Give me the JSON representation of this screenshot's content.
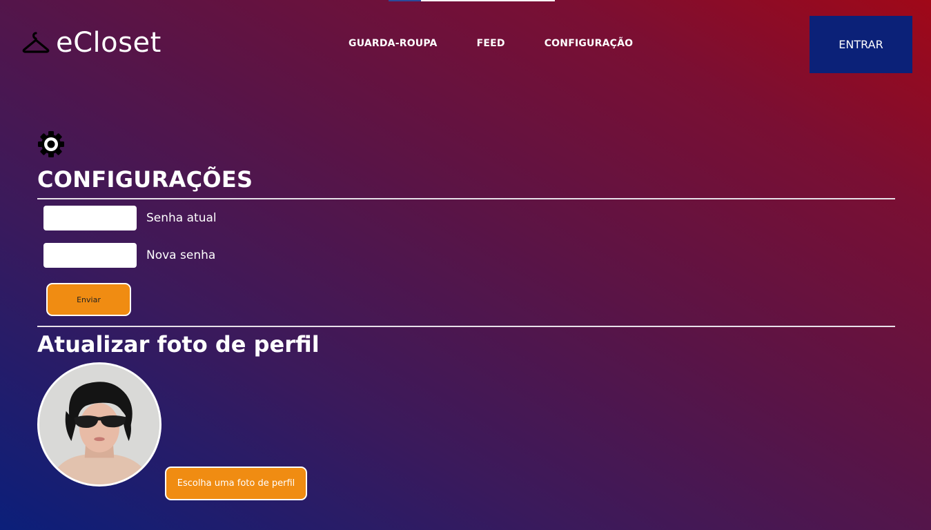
{
  "header": {
    "brand": "eCloset",
    "nav": [
      "GUARDA-ROUPA",
      "FEED",
      "CONFIGURAÇÃO"
    ],
    "login_label": "ENTRAR"
  },
  "settings": {
    "title": "CONFIGURAÇÕES",
    "current_password_label": "Senha atual",
    "current_password_value": "",
    "new_password_label": "Nova senha",
    "new_password_value": "",
    "submit_label": "Enviar"
  },
  "profile": {
    "title": "Atualizar foto de perfil",
    "choose_label": "Escolha uma foto de perfil"
  },
  "colors": {
    "accent_orange": "#f08c12",
    "login_blue": "#0b2178",
    "gradient_top_right": "#a00818",
    "gradient_bottom_left": "#0b1f7a"
  },
  "icons": [
    "hanger-icon",
    "gear-icon"
  ]
}
